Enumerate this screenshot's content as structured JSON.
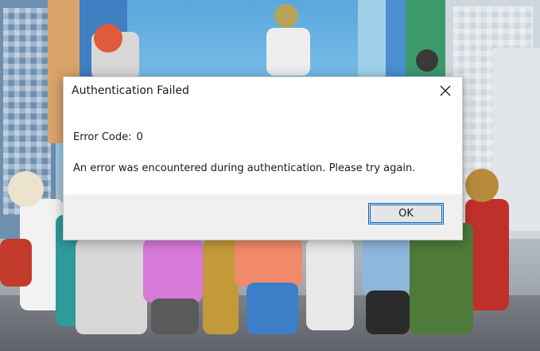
{
  "dialog": {
    "title": "Authentication Failed",
    "close_icon": "close-icon",
    "error_code_label": "Error Code:",
    "error_code_value": "0",
    "message": "An error was encountered during authentication. Please try again.",
    "ok_label": "OK"
  },
  "colors": {
    "accent": "#0067c0",
    "dialog_bg": "#ffffff",
    "footer_bg": "#f0f0f0"
  }
}
